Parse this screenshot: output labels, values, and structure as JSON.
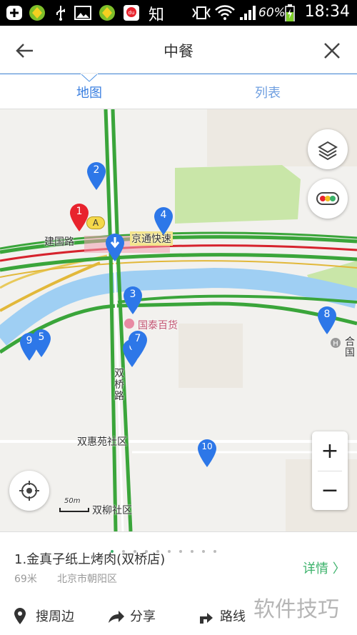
{
  "status_bar": {
    "battery_percent": "60%",
    "time": "18:34",
    "app_icon_text": "知"
  },
  "header": {
    "title": "中餐",
    "back_icon": "back-arrow-icon",
    "close_icon": "close-icon"
  },
  "tabs": [
    {
      "label": "地图",
      "active": true
    },
    {
      "label": "列表",
      "active": false
    }
  ],
  "map": {
    "labels": {
      "jianguo_road": "建国路",
      "jingtong_expressway": "京通快速",
      "guotai_store": "国泰百货",
      "shuangqiao_road": "双\n桥\n路",
      "shuanghuiyuan": "双惠苑社区",
      "shuangliu": "双柳社区",
      "edge_label": "国",
      "edge_label_top": "合",
      "scale": "50m",
      "marker_a": "A"
    },
    "pins": [
      {
        "num": "1",
        "color": "#e8232d"
      },
      {
        "num": "2",
        "color": "#2d77e8"
      },
      {
        "num": "3",
        "color": "#2d77e8"
      },
      {
        "num": "4",
        "color": "#2d77e8"
      },
      {
        "num": "5",
        "color": "#2d77e8"
      },
      {
        "num": "6",
        "color": "#2d77e8"
      },
      {
        "num": "7",
        "color": "#2d77e8"
      },
      {
        "num": "8",
        "color": "#2d77e8"
      },
      {
        "num": "9",
        "color": "#2d77e8"
      },
      {
        "num": "10",
        "color": "#2d77e8"
      }
    ],
    "zoom_in": "+",
    "zoom_out": "−"
  },
  "info": {
    "page_count": 10,
    "active_index": 0,
    "place_name": "1.金真子纸上烤肉(双桥店)",
    "distance": "69米",
    "address": "北京市朝阳区",
    "detail": "详情 〉",
    "actions": [
      {
        "label": "搜周边",
        "icon": "location-pin-icon"
      },
      {
        "label": "分享",
        "icon": "share-arrow-icon"
      },
      {
        "label": "路线",
        "icon": "route-icon"
      }
    ]
  },
  "watermark": "软件技巧",
  "colors": {
    "accent_blue": "#3a7fe0",
    "accent_green": "#3bb26a",
    "pin_blue": "#2d77e8",
    "pin_red": "#e8232d"
  }
}
